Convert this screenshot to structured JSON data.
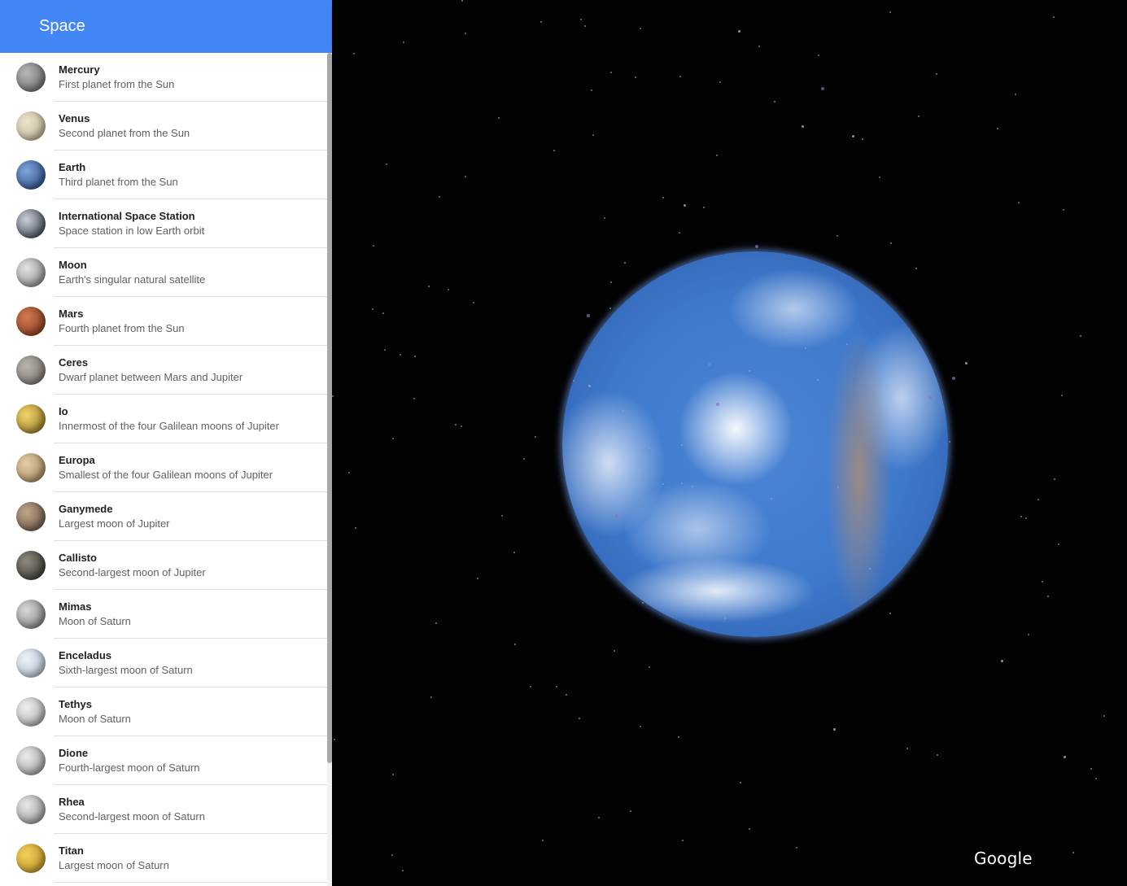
{
  "sidebar": {
    "title": "Space",
    "items": [
      {
        "name": "Mercury",
        "desc": "First planet from the Sun",
        "colors": [
          "#b7b7b7",
          "#5f5f5f"
        ]
      },
      {
        "name": "Venus",
        "desc": "Second planet from the Sun",
        "colors": [
          "#ece3cf",
          "#b8a989"
        ]
      },
      {
        "name": "Earth",
        "desc": "Third planet from the Sun",
        "colors": [
          "#7fa6d8",
          "#1f3f78"
        ]
      },
      {
        "name": "International Space Station",
        "desc": "Space station in low Earth orbit",
        "colors": [
          "#c9ced6",
          "#2a3140"
        ]
      },
      {
        "name": "Moon",
        "desc": "Earth's singular natural satellite",
        "colors": [
          "#e2e2e2",
          "#7c7c7c"
        ]
      },
      {
        "name": "Mars",
        "desc": "Fourth planet from the Sun",
        "colors": [
          "#d07a50",
          "#7a3218"
        ]
      },
      {
        "name": "Ceres",
        "desc": "Dwarf planet between Mars and Jupiter",
        "colors": [
          "#b9b4ad",
          "#6d6862"
        ]
      },
      {
        "name": "Io",
        "desc": "Innermost of the four Galilean moons of Jupiter",
        "colors": [
          "#f1d46a",
          "#8a6c1d"
        ]
      },
      {
        "name": "Europa",
        "desc": "Smallest of the four Galilean moons of Jupiter",
        "colors": [
          "#e4cfa7",
          "#9a7a50"
        ]
      },
      {
        "name": "Ganymede",
        "desc": "Largest moon of Jupiter",
        "colors": [
          "#bfa68a",
          "#5d4b3c"
        ]
      },
      {
        "name": "Callisto",
        "desc": "Second-largest moon of Jupiter",
        "colors": [
          "#8f8a7d",
          "#2b2a26"
        ]
      },
      {
        "name": "Mimas",
        "desc": "Moon of Saturn",
        "colors": [
          "#d9d9d9",
          "#707070"
        ]
      },
      {
        "name": "Enceladus",
        "desc": "Sixth-largest moon of Saturn",
        "colors": [
          "#eef3f8",
          "#a2b4c6"
        ]
      },
      {
        "name": "Tethys",
        "desc": "Moon of Saturn",
        "colors": [
          "#f0f0f0",
          "#9a9a9a"
        ]
      },
      {
        "name": "Dione",
        "desc": "Fourth-largest moon of Saturn",
        "colors": [
          "#ececec",
          "#8c8c8c"
        ]
      },
      {
        "name": "Rhea",
        "desc": "Second-largest moon of Saturn",
        "colors": [
          "#e8e8e8",
          "#888888"
        ]
      },
      {
        "name": "Titan",
        "desc": "Largest moon of Saturn",
        "colors": [
          "#f2cf5a",
          "#b38a1e"
        ]
      }
    ]
  },
  "logo": "Google",
  "colors": {
    "header": "#4285f4",
    "background": "#030304"
  }
}
